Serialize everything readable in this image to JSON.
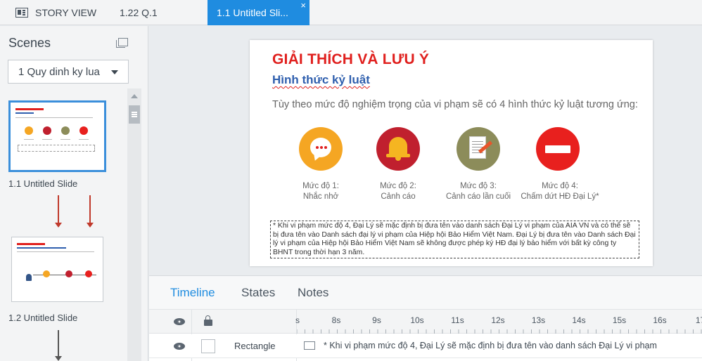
{
  "tabs": {
    "story_view": "STORY VIEW",
    "scene_tab": "1.22 Q.1",
    "active_tab": "1.1 Untitled Sli...",
    "close_glyph": "×"
  },
  "scenes_panel": {
    "title": "Scenes",
    "selected_scene": "1 Quy dinh ky lua",
    "slides": [
      {
        "label": "1.1 Untitled Slide"
      },
      {
        "label": "1.2 Untitled Slide"
      }
    ]
  },
  "slide": {
    "title": "GIẢI THÍCH VÀ LƯU Ý",
    "subtitle": "Hình thức kỷ luật",
    "intro": "Tùy theo mức độ nghiệm trọng của vi phạm sẽ có 4 hình thức kỷ luật tương ứng:",
    "levels": [
      {
        "line1": "Mức độ 1:",
        "line2": "Nhắc nhở",
        "icon": "chat-bubble-icon",
        "color": "#f5a623"
      },
      {
        "line1": "Mức độ 2:",
        "line2": "Cảnh cáo",
        "icon": "bell-icon",
        "color": "#c0202e"
      },
      {
        "line1": "Mức độ 3:",
        "line2": "Cảnh cáo lần cuối",
        "icon": "document-icon",
        "color": "#8c8c5a"
      },
      {
        "line1": "Mức độ 4:",
        "line2": "Chấm dứt HĐ Đại Lý*",
        "icon": "stop-icon",
        "color": "#e8201e"
      }
    ],
    "note": "* Khi vi phạm mức độ 4, Đại Lý sẽ mặc định bị đưa tên vào danh sách Đại Lý vi phạm của AIA VN và có thể sẽ bị đưa tên vào Danh sách đại lý vi phạm của Hiệp hội Bảo Hiểm Việt Nam.  Đại Lý bị đưa tên vào Danh sách Đại lý vi phạm của Hiệp hội Bảo Hiểm Việt Nam sẽ không được phép ký HĐ đại lý bảo hiểm với bất kỳ công ty BHNT trong thời hạn 3 năm."
  },
  "timeline_panel": {
    "tabs": [
      "Timeline",
      "States",
      "Notes"
    ],
    "ruler_labels": [
      "s",
      "8s",
      "9s",
      "10s",
      "11s",
      "12s",
      "13s",
      "14s",
      "15s",
      "16s",
      "17"
    ],
    "row": {
      "name": "Rectangle",
      "bar_text": "* Khi vi phạm mức độ 4, Đại Lý sẽ mặc định bị đưa tên vào danh sách Đại Lý vi phạm"
    }
  },
  "colors": {
    "accent": "#1f8ce0",
    "title_red": "#e0201e",
    "subtitle_blue": "#2f5fae"
  }
}
